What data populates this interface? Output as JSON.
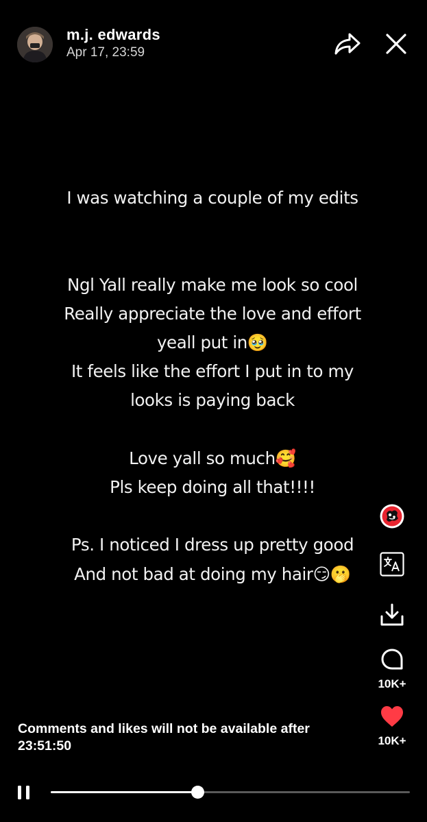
{
  "header": {
    "user_name": "m.j. edwards",
    "timestamp": "Apr 17, 23:59"
  },
  "post": {
    "text": "I was watching a couple of my edits\n\n\nNgl Yall really make me look so cool\nReally appreciate the love and effort\nyeall put in🥹\nIt feels like the effort I put in to my\nlooks is paying back\n\nLove yall so much🥰\nPls keep doing all that!!!!\n\nPs. I noticed I dress up pretty good\nAnd not bad at doing my hair😏🫢"
  },
  "actions": {
    "comment_count": "10K+",
    "like_count": "10K+"
  },
  "icons": {
    "share": "share-arrow-icon",
    "close": "close-icon",
    "sticker": "sticker-icon",
    "translate": "translate-icon",
    "download": "download-icon",
    "comment": "comment-bubble-icon",
    "like": "heart-icon",
    "pause": "pause-icon"
  },
  "colors": {
    "background": "#000000",
    "heart": "#ff3b45",
    "sticker_badge": "#e8242f"
  },
  "notice": {
    "text": "Comments and likes will not be available after 23:51:50"
  },
  "player": {
    "progress": 0.409
  }
}
